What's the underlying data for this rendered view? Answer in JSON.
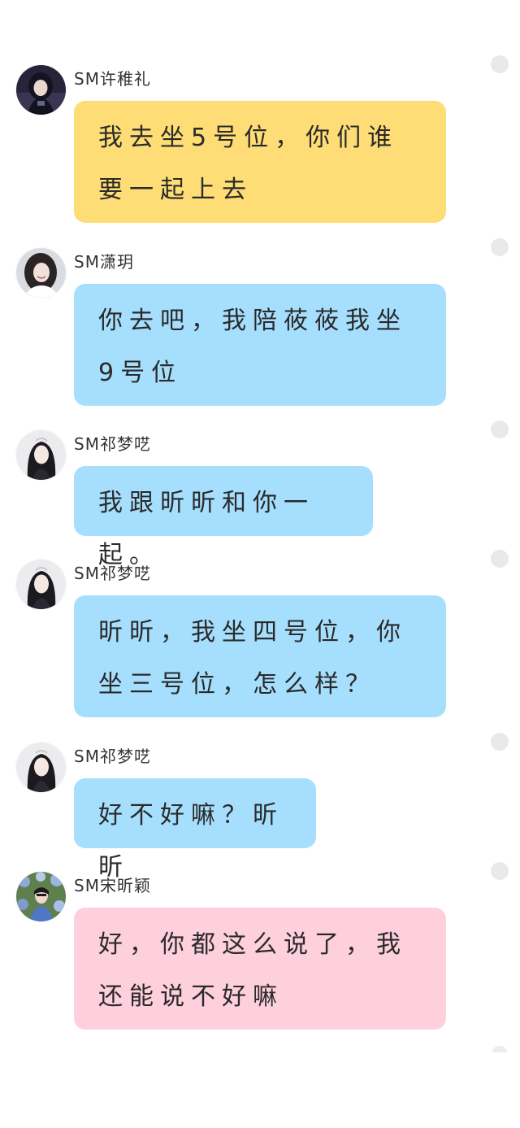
{
  "messages": [
    {
      "sender": "SM许稚礼",
      "text": "我去坐5号位，你们谁要一起上去",
      "bubble_color": "#fedd76",
      "avatar_icon": "avatar-dark-outfit"
    },
    {
      "sender": "SM潇玥",
      "text": "你去吧，我陪莜莜我坐9号位",
      "bubble_color": "#a6dffd",
      "avatar_icon": "avatar-smiling-portrait"
    },
    {
      "sender": "SM祁梦呓",
      "text": "我跟昕昕和你一起。",
      "bubble_color": "#a6dffd",
      "avatar_icon": "avatar-long-hair-portrait"
    },
    {
      "sender": "SM祁梦呓",
      "text": "昕昕，我坐四号位，你坐三号位，怎么样？",
      "bubble_color": "#a6dffd",
      "avatar_icon": "avatar-long-hair-portrait"
    },
    {
      "sender": "SM祁梦呓",
      "text": "好不好嘛？昕昕",
      "bubble_color": "#a6dffd",
      "avatar_icon": "avatar-long-hair-portrait"
    },
    {
      "sender": "SM宋昕颖",
      "text": "好，你都这么说了，我还能说不好嘛",
      "bubble_color": "#fecfdc",
      "avatar_icon": "avatar-flowers-portrait"
    }
  ]
}
